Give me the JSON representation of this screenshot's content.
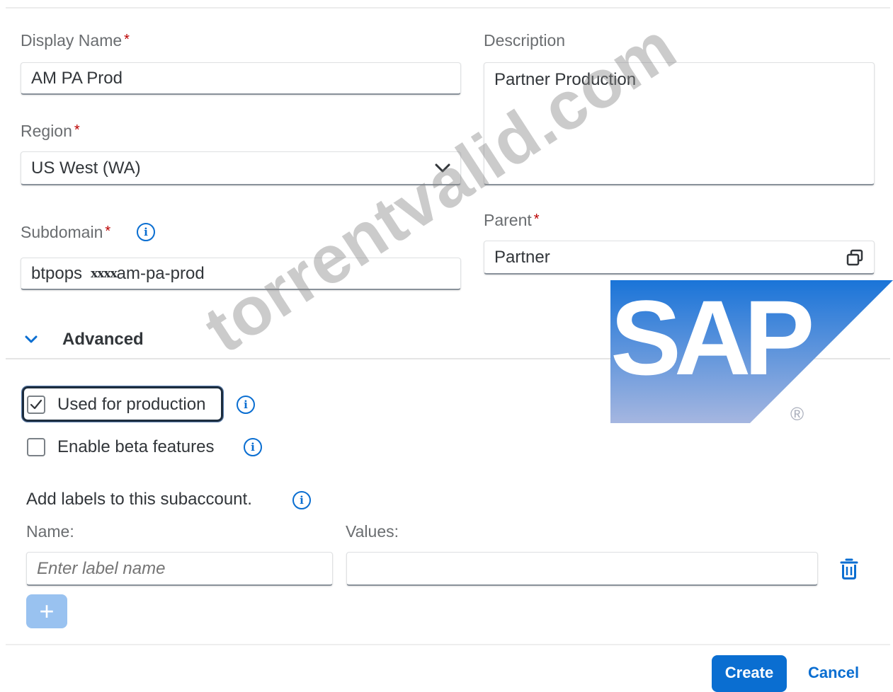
{
  "form": {
    "display_name": {
      "label": "Display Name",
      "required": "*",
      "value": "AM PA Prod"
    },
    "description": {
      "label": "Description",
      "value": "Partner Production"
    },
    "region": {
      "label": "Region",
      "required": "*",
      "value": "US West (WA)"
    },
    "subdomain": {
      "label": "Subdomain",
      "required": "*",
      "value_prefix": "btpops",
      "value_redacted": "xxxx",
      "value_suffix": "am-pa-prod"
    },
    "parent": {
      "label": "Parent",
      "required": "*",
      "value": "Partner"
    }
  },
  "advanced": {
    "title": "Advanced",
    "used_for_production": {
      "label": "Used for production",
      "checked": true
    },
    "enable_beta": {
      "label": "Enable beta features",
      "checked": false
    }
  },
  "labels_section": {
    "heading": "Add labels to this subaccount.",
    "name_header": "Name:",
    "values_header": "Values:",
    "name_placeholder": "Enter label name",
    "add_symbol": "+"
  },
  "footer": {
    "create_label": "Create",
    "cancel_label": "Cancel"
  },
  "overlays": {
    "watermark_text": "torrentvalid.com",
    "logo_text": "SAP",
    "registered_mark": "®"
  },
  "colors": {
    "accent": "#0a6ed1",
    "required": "#bb0000",
    "label": "#6a6d70",
    "logo_gradient_top": "#1a74d8",
    "logo_gradient_bottom": "#a5b6e0"
  },
  "icons": {
    "info": "info-icon",
    "chevron": "chevron-down-icon",
    "copy": "copy-icon",
    "trash": "trash-icon",
    "checkmark": "checkmark-icon"
  }
}
